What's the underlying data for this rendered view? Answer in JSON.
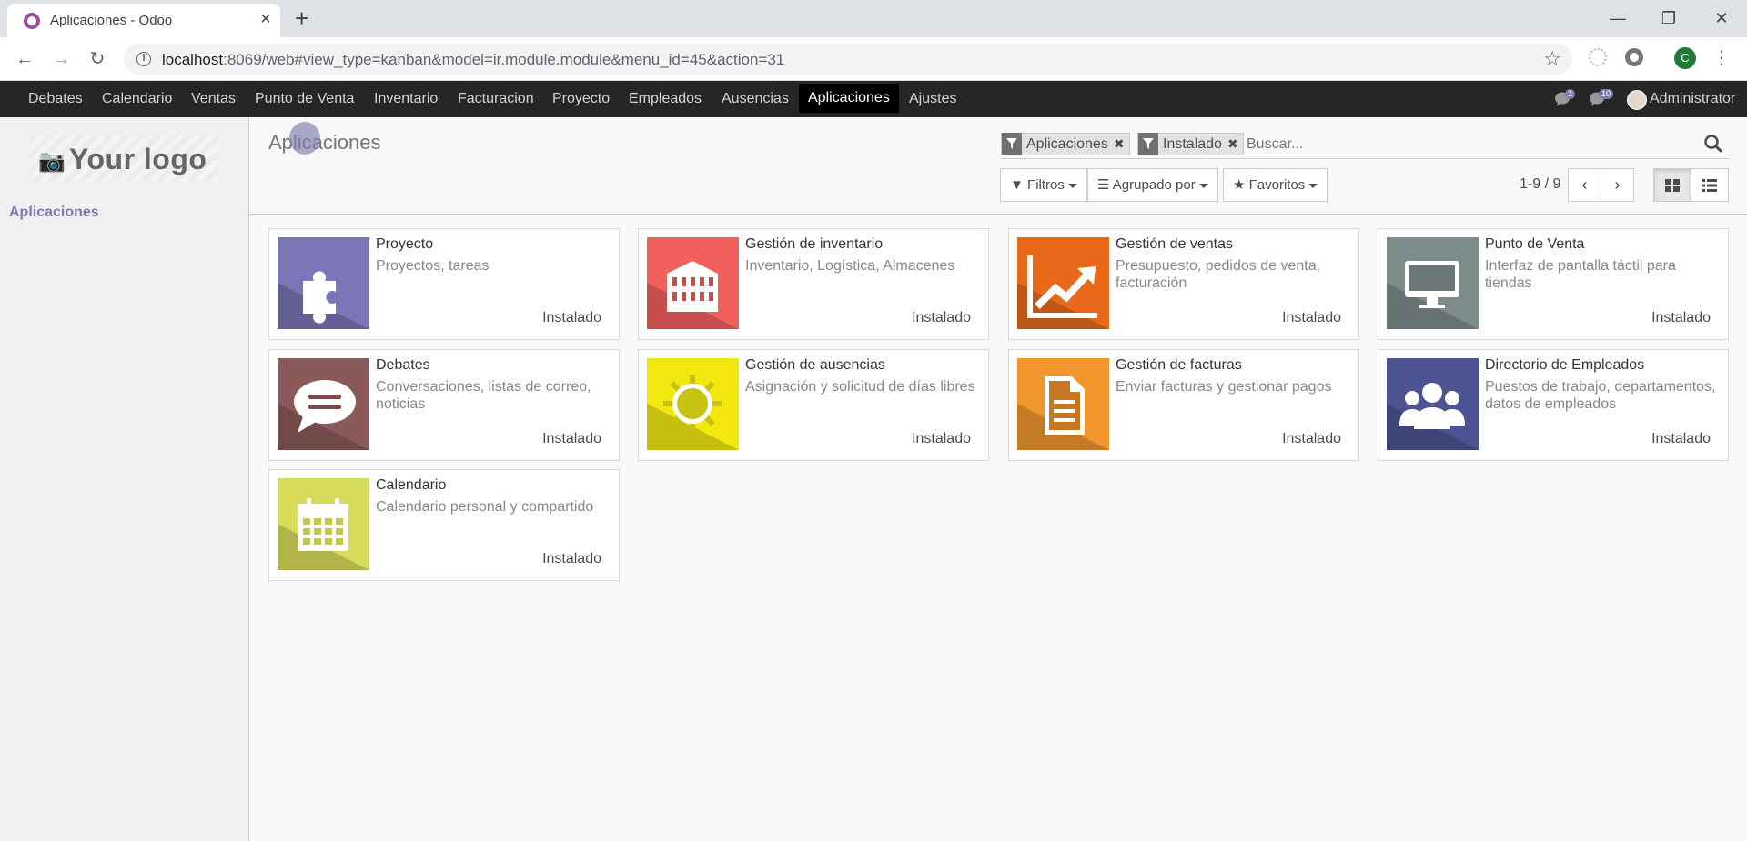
{
  "browser": {
    "tab_title": "Aplicaciones - Odoo",
    "url_host": "localhost",
    "url_rest": ":8069/web#view_type=kanban&model=ir.module.module&menu_id=45&action=31",
    "profile_initial": "C"
  },
  "top_menu": {
    "items": [
      "Debates",
      "Calendario",
      "Ventas",
      "Punto de Venta",
      "Inventario",
      "Facturacion",
      "Proyecto",
      "Empleados",
      "Ausencias",
      "Aplicaciones",
      "Ajustes"
    ],
    "active": "Aplicaciones",
    "messages_count": "2",
    "activity_count": "10",
    "user_name": "Administrator"
  },
  "sidebar": {
    "logo_text": "Your logo",
    "links": [
      "Aplicaciones"
    ]
  },
  "control_panel": {
    "breadcrumb": "Aplicaciones",
    "facets": [
      "Aplicaciones",
      "Instalado"
    ],
    "search_placeholder": "Buscar...",
    "filters_label": "Filtros",
    "groupby_label": "Agrupado por",
    "favorites_label": "Favoritos",
    "pager": "1-9 / 9"
  },
  "apps": [
    {
      "name": "Proyecto",
      "summary": "Proyectos, tareas",
      "status": "Instalado",
      "icon": "puzzle-icon",
      "color": "#7b76b8"
    },
    {
      "name": "Gestión de inventario",
      "summary": "Inventario, Logística, Almacenes",
      "status": "Instalado",
      "icon": "warehouse-icon",
      "color": "#f2605e"
    },
    {
      "name": "Gestión de ventas",
      "summary": "Presupuesto, pedidos de venta, facturación",
      "status": "Instalado",
      "icon": "chart-trend-icon",
      "color": "#e8691a"
    },
    {
      "name": "Punto de Venta",
      "summary": "Interfaz de pantalla táctil para tiendas",
      "status": "Instalado",
      "icon": "monitor-icon",
      "color": "#7e8b8b"
    },
    {
      "name": "Debates",
      "summary": "Conversaciones, listas de correo, noticias",
      "status": "Instalado",
      "icon": "speech-bubble-icon",
      "color": "#8a5959"
    },
    {
      "name": "Gestión de ausencias",
      "summary": "Asignación y solicitud de días libres",
      "status": "Instalado",
      "icon": "sun-icon",
      "color": "#f2e810"
    },
    {
      "name": "Gestión de facturas",
      "summary": "Enviar facturas y gestionar pagos",
      "status": "Instalado",
      "icon": "document-icon",
      "color": "#f0962c"
    },
    {
      "name": "Directorio de Empleados",
      "summary": "Puestos de trabajo, departamentos, datos de empleados",
      "status": "Instalado",
      "icon": "people-icon",
      "color": "#4c5591"
    },
    {
      "name": "Calendario",
      "summary": "Calendario personal y compartido",
      "status": "Instalado",
      "icon": "calendar-icon",
      "color": "#d7dc5a"
    }
  ]
}
